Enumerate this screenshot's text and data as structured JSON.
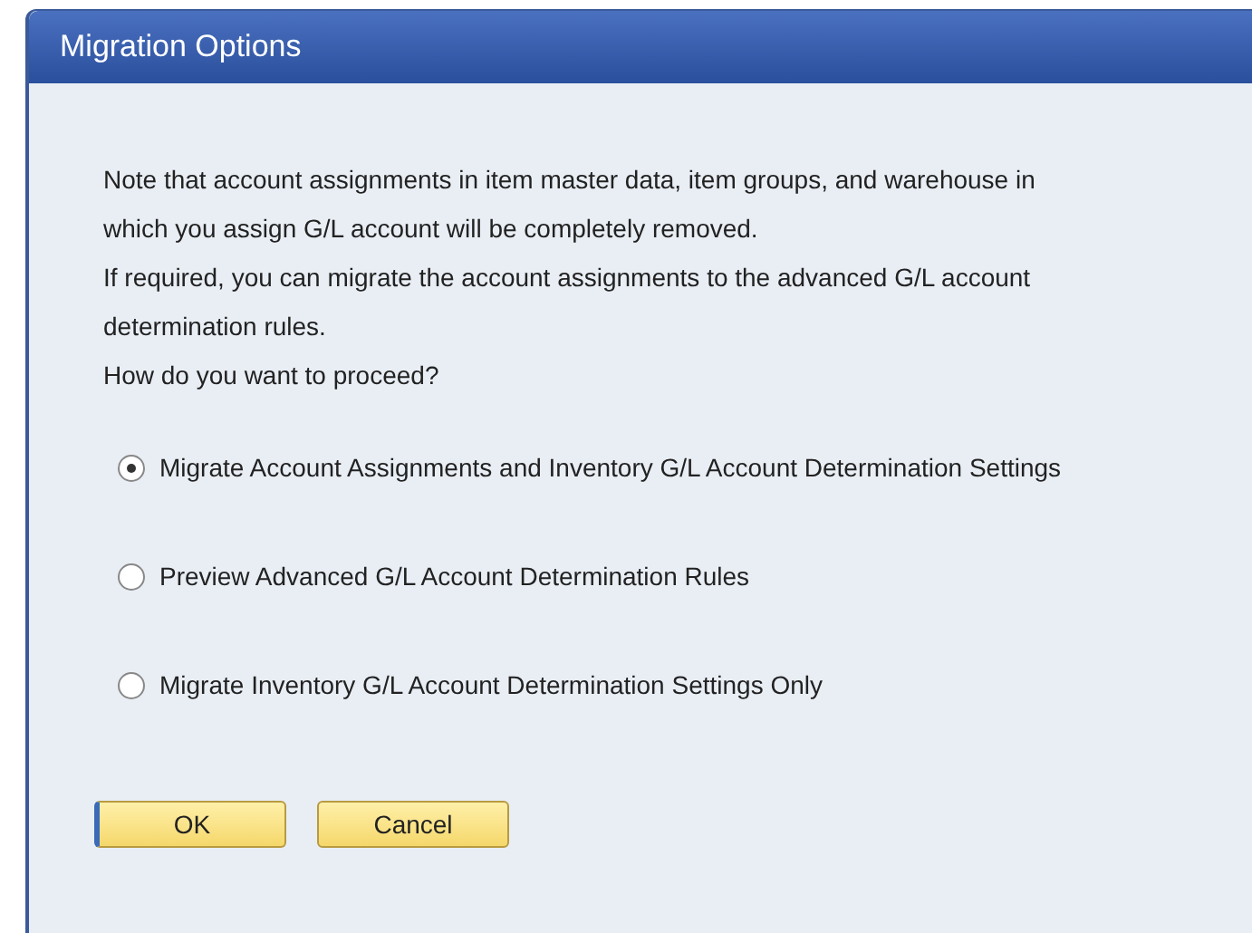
{
  "window": {
    "title": "Migration Options"
  },
  "message_lines": [
    "Note that account assignments in item master data, item groups, and warehouse in",
    "which you assign G/L account will be completely removed.",
    "If required, you can migrate the account assignments to the advanced G/L account",
    "determination rules.",
    "How do you want to proceed?"
  ],
  "options": [
    {
      "label": "Migrate Account Assignments and Inventory G/L Account Determination Settings",
      "selected": true
    },
    {
      "label": "Preview Advanced G/L Account Determination Rules",
      "selected": false
    },
    {
      "label": "Migrate Inventory G/L Account Determination Settings Only",
      "selected": false
    }
  ],
  "buttons": [
    {
      "label": "OK",
      "focused": true
    },
    {
      "label": "Cancel",
      "focused": false
    }
  ]
}
